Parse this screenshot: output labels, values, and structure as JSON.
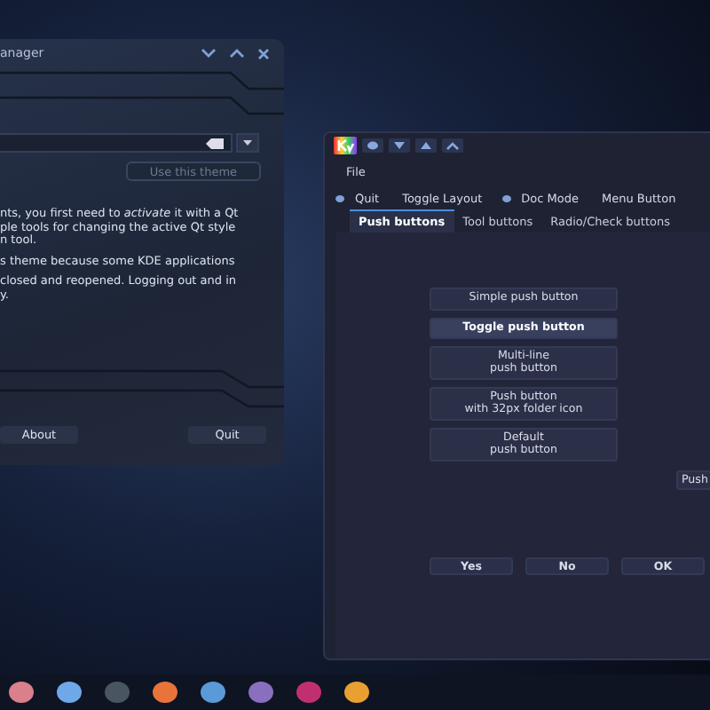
{
  "left_window": {
    "title": "anager",
    "theme_button": {
      "label": "Use this theme",
      "disabled": true
    },
    "paragraphs": [
      [
        "nts, you first need to *activate* it with a Qt",
        "ple tools for changing the active Qt style",
        "n tool."
      ],
      [
        "s theme because some KDE applications"
      ],
      [
        "closed and reopened. Logging out and in",
        "y."
      ]
    ],
    "buttons": [
      "About",
      "Quit"
    ]
  },
  "right_window": {
    "menu": [
      "File"
    ],
    "toolbar": [
      {
        "label": "Quit",
        "dot": true
      },
      {
        "label": "Toggle Layout",
        "dot": false
      },
      {
        "label": "Doc Mode",
        "dot": true
      },
      {
        "label": "Menu Button",
        "dot": false
      }
    ],
    "tabs": [
      {
        "label": "Push buttons",
        "selected": true
      },
      {
        "label": "Tool buttons",
        "selected": false
      },
      {
        "label": "Radio/Check buttons",
        "selected": false
      }
    ],
    "push_buttons": [
      {
        "lines": [
          "Simple push button"
        ],
        "checked": false
      },
      {
        "lines": [
          "Toggle push button"
        ],
        "checked": true
      },
      {
        "lines": [
          "Multi-line",
          "push button"
        ],
        "checked": false
      },
      {
        "lines": [
          "Push button",
          "with 32px folder icon"
        ],
        "checked": false
      },
      {
        "lines": [
          "Default",
          "push button"
        ],
        "checked": false
      }
    ],
    "side_button": "Push",
    "dialog_buttons": [
      "Yes",
      "No",
      "OK"
    ]
  },
  "taskbar": [
    {
      "color": "#d9808c"
    },
    {
      "color": "#6fa8e8"
    },
    {
      "color": "#4a5562"
    },
    {
      "color": "#e8743b"
    },
    {
      "color": "#5a9ad8"
    },
    {
      "color": "#8a6fc0"
    },
    {
      "color": "#c03070"
    },
    {
      "color": "#e8a030"
    }
  ]
}
